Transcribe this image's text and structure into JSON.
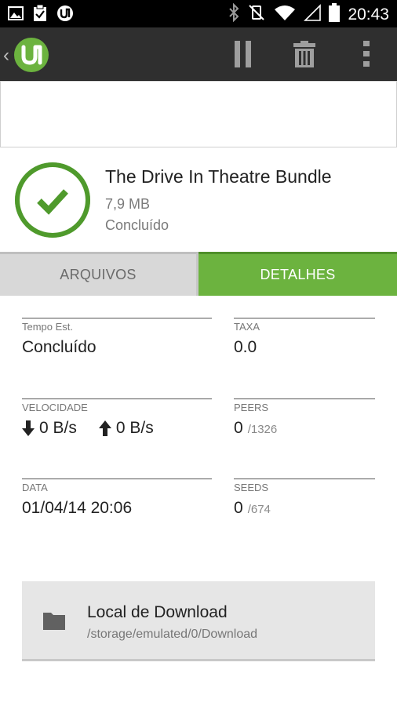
{
  "status_bar": {
    "time": "20:43",
    "left_icons": [
      "image-icon",
      "clipboard-check-icon",
      "utorrent-notification-icon"
    ],
    "right_icons": [
      "bluetooth-icon",
      "vibrate-off-icon",
      "wifi-icon",
      "signal-icon",
      "battery-icon"
    ]
  },
  "action_bar": {
    "brand_color": "#6cb33f",
    "buttons": [
      "pause-icon",
      "trash-icon",
      "overflow-menu-icon"
    ]
  },
  "torrent": {
    "name": "The Drive In Theatre Bundle",
    "size": "7,9 MB",
    "status": "Concluído",
    "progress": 1.0
  },
  "tabs": {
    "files": "ARQUIVOS",
    "details": "DETALHES",
    "active": "details"
  },
  "details": {
    "eta": {
      "label": "Tempo Est.",
      "value": "Concluído"
    },
    "ratio": {
      "label": "TAXA",
      "value": "0.0"
    },
    "speed": {
      "label": "VELOCIDADE",
      "down": "0 B/s",
      "up": "0 B/s"
    },
    "peers": {
      "label": "PEERS",
      "value": "0",
      "total": "/1326"
    },
    "date": {
      "label": "DATA",
      "value": "01/04/14 20:06"
    },
    "seeds": {
      "label": "SEEDS",
      "value": "0",
      "total": "/674"
    }
  },
  "download_location": {
    "title": "Local de Download",
    "path": "/storage/emulated/0/Download"
  }
}
